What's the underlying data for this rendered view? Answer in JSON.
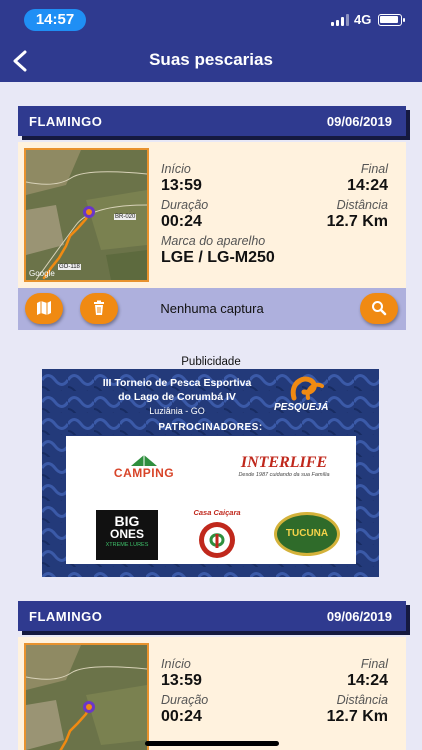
{
  "status_bar": {
    "time": "14:57",
    "network": "4G"
  },
  "header": {
    "title": "Suas pescarias"
  },
  "labels": {
    "start": "Início",
    "end": "Final",
    "duration": "Duração",
    "distance": "Distância",
    "device": "Marca do aparelho"
  },
  "cards": [
    {
      "name": "FLAMINGO",
      "date": "09/06/2019",
      "start": "13:59",
      "end": "14:24",
      "duration": "00:24",
      "distance": "12.7 Km",
      "device": "LGE / LG-M250",
      "no_catch": "Nenhuma captura"
    },
    {
      "name": "FLAMINGO",
      "date": "09/06/2019",
      "start": "13:59",
      "end": "14:24",
      "duration": "00:24",
      "distance": "12.7 Km"
    }
  ],
  "map": {
    "google": "Google",
    "road_1": "BR-020",
    "road_2": "GO-118"
  },
  "ad": {
    "label": "Publicidade",
    "title_line1": "III Torneio de Pesca Esportiva",
    "title_line2": "do Lago de Corumbá IV",
    "location": "Luziânia - GO",
    "brand": "PESQUEJÁ",
    "sponsors_heading": "PATROCINADORES:",
    "sponsor_camping": "CAMPING",
    "sponsor_interlife": "INTERLIFE",
    "sponsor_interlife_tag": "Desde 1987 cuidando da sua Família",
    "sponsor_bigones_1": "BIG",
    "sponsor_bigones_2": "ONES",
    "sponsor_bigones_3": "XTREME LURES",
    "sponsor_casa": "Casa Caiçara",
    "sponsor_tucuna": "TUCUNA"
  },
  "colors": {
    "header_bg": "#2f3a8f",
    "card_body": "#fff2de",
    "action_bar": "#aeb0dd",
    "accent": "#f08a12"
  },
  "icons": [
    "back-icon",
    "map-icon",
    "trash-icon",
    "search-icon"
  ]
}
